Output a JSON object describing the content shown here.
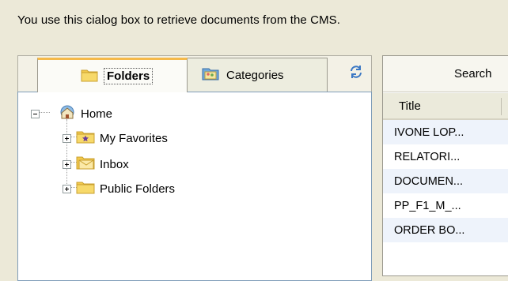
{
  "intro_text": "You use this cialog box to retrieve documents from the CMS.",
  "tabs": [
    {
      "label": "Folders",
      "icon": "folder-icon",
      "active": true
    },
    {
      "label": "Categories",
      "icon": "categories-icon",
      "active": false
    }
  ],
  "tree": {
    "root": {
      "label": "Home",
      "icon": "home-icon",
      "expanded": true
    },
    "children": [
      {
        "label": "My Favorites",
        "icon": "favorites-folder-icon"
      },
      {
        "label": "Inbox",
        "icon": "inbox-icon"
      },
      {
        "label": "Public Folders",
        "icon": "folder-icon"
      }
    ]
  },
  "right_panel": {
    "search_label": "Search",
    "column_title": "Title",
    "rows": [
      "IVONE LOP...",
      "RELATORI...",
      "DOCUMEN...",
      "PP_F1_M_...",
      "ORDER BO..."
    ]
  },
  "colors": {
    "background": "#ece9d8",
    "accent_tab": "#f5b94a",
    "tree_border": "#7f9db9",
    "row_alt": "#eef3fb"
  }
}
